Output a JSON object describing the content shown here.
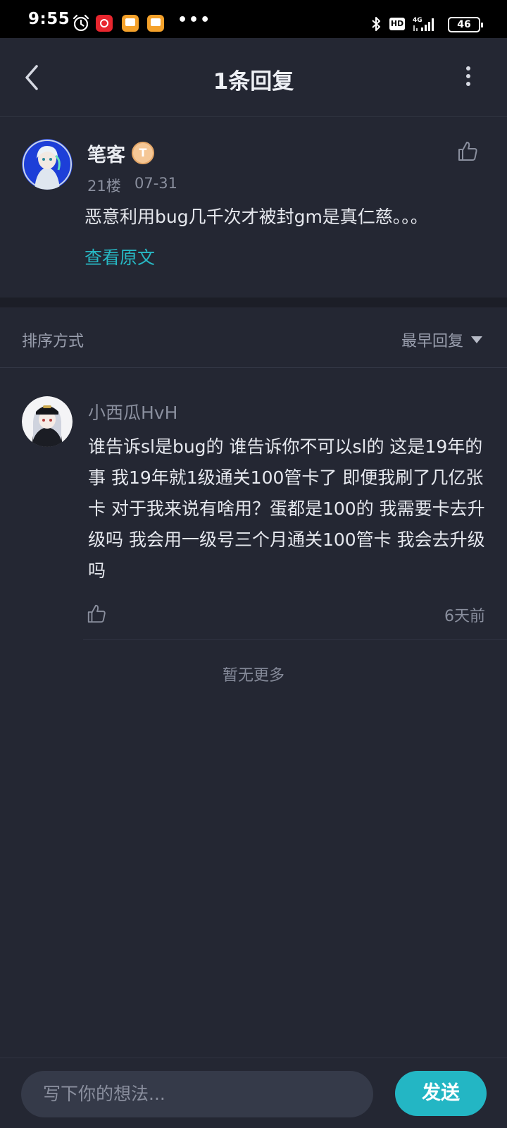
{
  "status_bar": {
    "time": "9:55",
    "battery": "46",
    "hd_label": "HD",
    "network_label": "4G",
    "icons": [
      "alarm-icon",
      "netease-music-icon",
      "notes-app-icon",
      "notes-app-icon",
      "more-dots-icon",
      "bluetooth-icon",
      "hd-icon",
      "signal-icon",
      "battery-icon"
    ]
  },
  "header": {
    "title": "1条回复",
    "back_icon": "chevron-left-icon",
    "more_icon": "vertical-dots-icon"
  },
  "original_comment": {
    "author": "笔客",
    "badge": "T",
    "floor": "21楼",
    "date": "07-31",
    "text": "恶意利用bug几千次才被封gm是真仁慈。。。",
    "view_original": "查看原文",
    "like_icon": "thumbs-up-icon"
  },
  "sort": {
    "label": "排序方式",
    "value": "最早回复",
    "caret_icon": "caret-down-icon"
  },
  "reply": {
    "author": "小西瓜HvH",
    "text": "谁告诉sl是bug的 谁告诉你不可以sl的 这是19年的事 我19年就1级通关100管卡了 即便我刷了几亿张卡 对于我来说有啥用？蛋都是100的 我需要卡去升级吗 我会用一级号三个月通关100管卡 我会去升级吗",
    "time": "6天前",
    "like_icon": "thumbs-up-icon"
  },
  "footer_note": "暂无更多",
  "composer": {
    "placeholder": "写下你的想法...",
    "send_label": "发送"
  },
  "colors": {
    "background": "#242733",
    "accent": "#23b6c4",
    "secondary_text": "#8a8f9e"
  }
}
